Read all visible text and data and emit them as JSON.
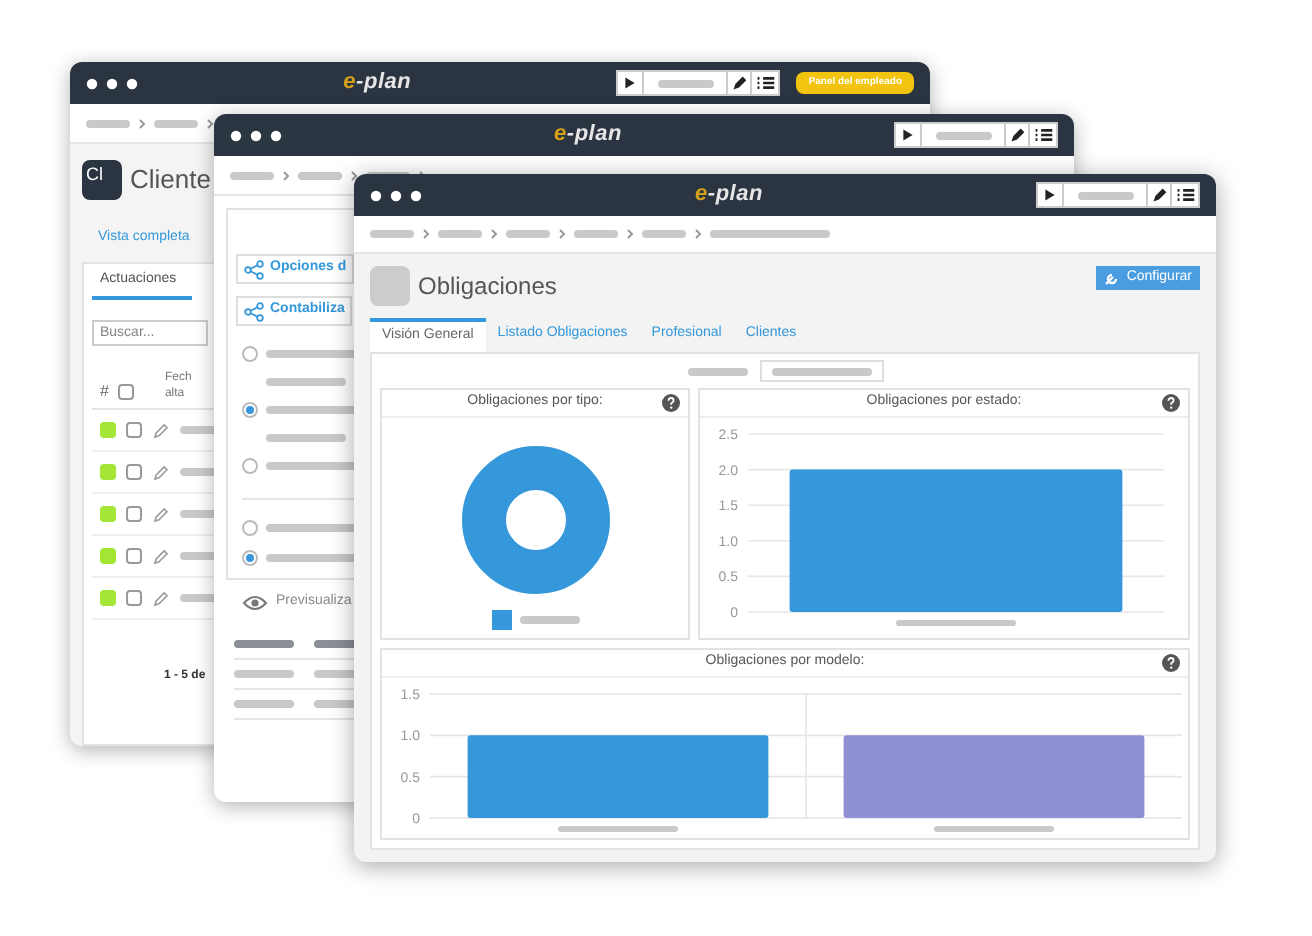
{
  "windows": [
    {
      "kind": "clients",
      "logo": "e-plan",
      "employee_button": "Panel del empleado",
      "initials": "Cl",
      "title": "Cliente",
      "link": "Vista completa",
      "tab": {
        "label": "Actuaciones",
        "selected": true
      },
      "search": {
        "placeholder": "Buscar..."
      },
      "select_all": {
        "checked": false
      },
      "columns": [
        "#",
        "Fech alta"
      ],
      "rows": [
        {
          "color": "#a3e635",
          "checked": false
        },
        {
          "color": "#a3e635",
          "checked": false
        },
        {
          "color": "#a3e635",
          "checked": false
        },
        {
          "color": "#a3e635",
          "checked": false
        },
        {
          "color": "#a3e635",
          "checked": false
        }
      ],
      "pagination": "1 - 5 de"
    },
    {
      "kind": "options",
      "logo": "e-plan",
      "buttons": [
        "Opciones d",
        "Contabiliza"
      ],
      "radios": [
        {
          "selected": false
        },
        {
          "selected": true
        },
        {
          "selected": false
        },
        {
          "selected": false
        },
        {
          "selected": true
        }
      ],
      "preview": "Previsualiza"
    },
    {
      "kind": "obligations",
      "logo": "e-plan",
      "title": "Obligaciones",
      "configure_button": "Configurar",
      "tabs": [
        {
          "label": "Visión General",
          "selected": true
        },
        {
          "label": "Listado Obligaciones",
          "selected": false
        },
        {
          "label": "Profesional",
          "selected": false
        },
        {
          "label": "Clientes",
          "selected": false
        }
      ],
      "charts": [
        {
          "kind": "donut",
          "title": "Obligaciones por tipo:"
        },
        {
          "kind": "bar",
          "title": "Obligaciones por estado:",
          "chart_data": {
            "type": "bar",
            "grid": true,
            "ylim": [
              0,
              2.5
            ],
            "yticks": [
              {
                "value": 0,
                "label": "0"
              },
              {
                "value": 0.5,
                "label": "0.5"
              },
              {
                "value": 1,
                "label": "1.0"
              },
              {
                "value": 1.5,
                "label": "1.5"
              },
              {
                "value": 2,
                "label": "2.0"
              },
              {
                "value": 2.5,
                "label": "2.5"
              }
            ],
            "series": [
              {
                "color": "#3498db",
                "values": [
                  2
                ]
              }
            ]
          }
        },
        {
          "kind": "bar",
          "title": "Obligaciones por modelo:",
          "chart_data": {
            "type": "bar",
            "grid": true,
            "ylim": [
              0,
              1.5
            ],
            "yticks": [
              {
                "value": 0,
                "label": "0"
              },
              {
                "value": 0.5,
                "label": "0.5"
              },
              {
                "value": 1,
                "label": "1.0"
              },
              {
                "value": 1.5,
                "label": "1.5"
              }
            ],
            "series": [
              {
                "color": "#3498db",
                "values": [
                  1,
                  null
                ]
              },
              {
                "color": "#9090d4",
                "values": [
                  null,
                  1
                ]
              }
            ]
          }
        }
      ]
    }
  ]
}
